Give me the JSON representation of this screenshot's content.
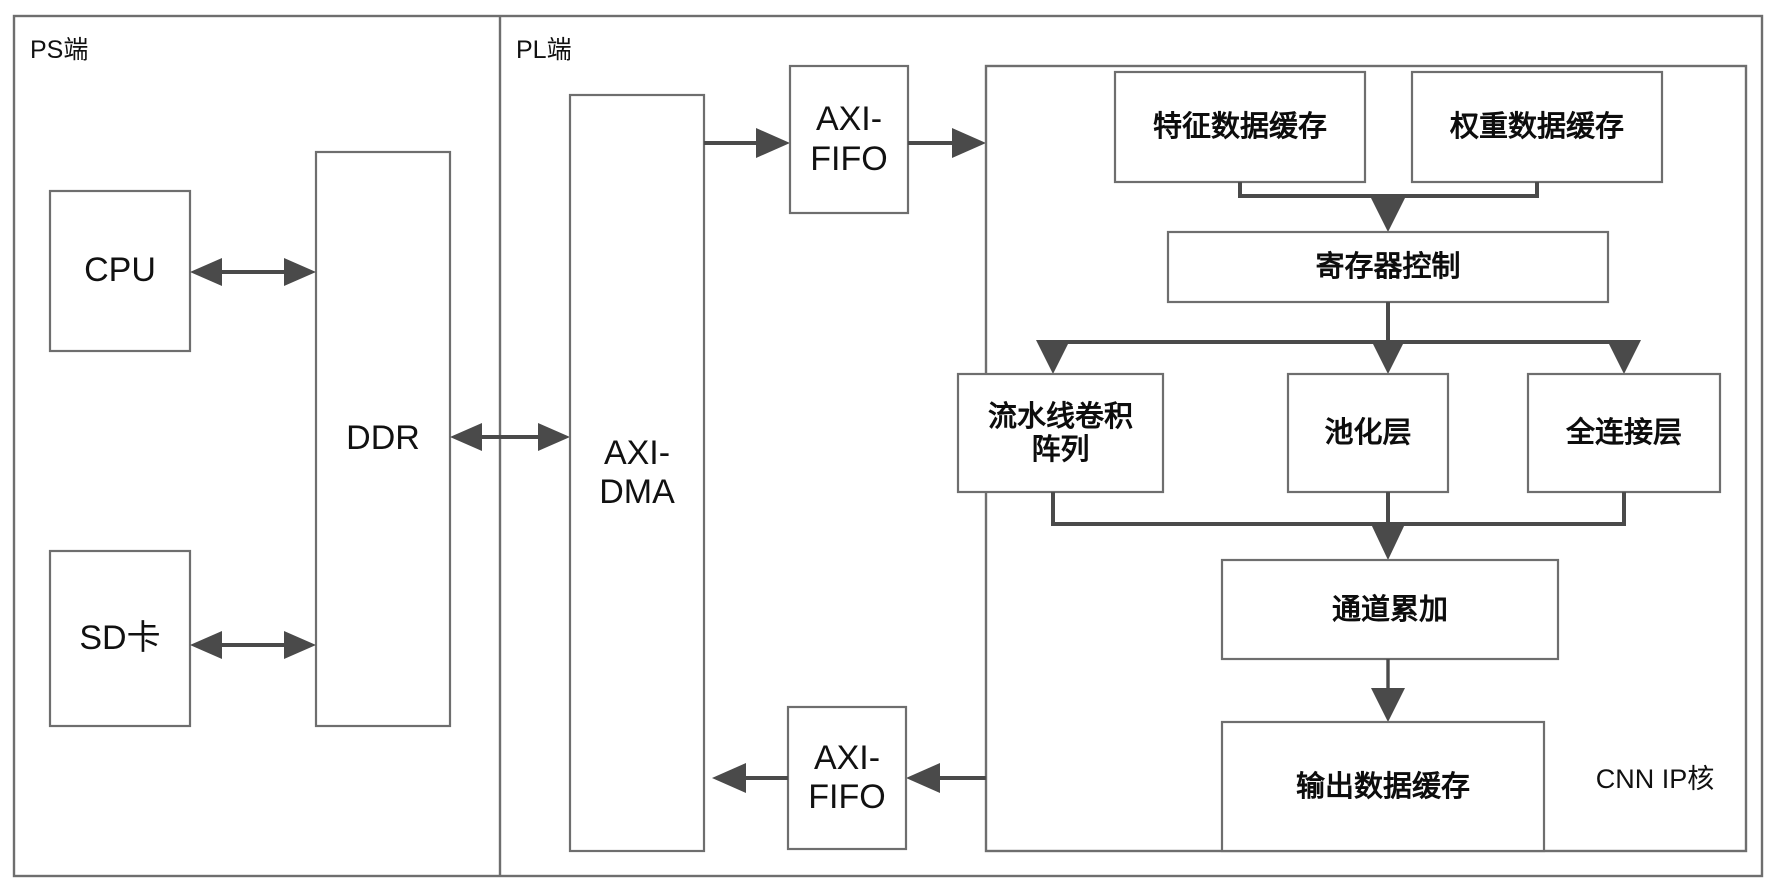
{
  "diagram": {
    "title": "FPGA SoC CNN Accelerator Block Diagram",
    "sections": [
      {
        "id": "ps",
        "label": "PS端"
      },
      {
        "id": "pl",
        "label": "PL端"
      }
    ],
    "corner_labels": [
      {
        "id": "cnn-ip-core",
        "label": "CNN IP核"
      }
    ],
    "blocks": [
      {
        "id": "cpu",
        "label": "CPU",
        "script": "latin"
      },
      {
        "id": "sd-card",
        "label": "SD卡",
        "script": "mixed"
      },
      {
        "id": "ddr",
        "label": "DDR",
        "script": "latin"
      },
      {
        "id": "axi-dma",
        "label": "AXI-\nDMA",
        "script": "latin"
      },
      {
        "id": "axi-fifo-in",
        "label": "AXI-\nFIFO",
        "script": "latin"
      },
      {
        "id": "axi-fifo-out",
        "label": "AXI-\nFIFO",
        "script": "latin"
      },
      {
        "id": "feature-buffer",
        "label": "特征数据缓存",
        "script": "cjk"
      },
      {
        "id": "weight-buffer",
        "label": "权重数据缓存",
        "script": "cjk"
      },
      {
        "id": "register-ctrl",
        "label": "寄存器控制",
        "script": "cjk"
      },
      {
        "id": "conv-array",
        "label": "流水线卷积\n阵列",
        "script": "cjk"
      },
      {
        "id": "pooling-layer",
        "label": "池化层",
        "script": "cjk"
      },
      {
        "id": "fc-layer",
        "label": "全连接层",
        "script": "cjk"
      },
      {
        "id": "channel-accum",
        "label": "通道累加",
        "script": "cjk"
      },
      {
        "id": "output-buffer",
        "label": "输出数据缓存",
        "script": "cjk"
      }
    ],
    "connections": [
      {
        "from": "cpu",
        "to": "ddr",
        "style": "bidirectional"
      },
      {
        "from": "sd-card",
        "to": "ddr",
        "style": "bidirectional"
      },
      {
        "from": "ddr",
        "to": "axi-dma",
        "style": "bidirectional"
      },
      {
        "from": "axi-dma",
        "to": "axi-fifo-in",
        "style": "directed"
      },
      {
        "from": "axi-fifo-in",
        "to": "cnn-ip-core",
        "style": "directed"
      },
      {
        "from": "feature-buffer",
        "to": "register-ctrl",
        "style": "directed"
      },
      {
        "from": "weight-buffer",
        "to": "register-ctrl",
        "style": "directed"
      },
      {
        "from": "register-ctrl",
        "to": "conv-array",
        "style": "directed"
      },
      {
        "from": "register-ctrl",
        "to": "pooling-layer",
        "style": "directed"
      },
      {
        "from": "register-ctrl",
        "to": "fc-layer",
        "style": "directed"
      },
      {
        "from": "conv-array",
        "to": "channel-accum",
        "style": "directed"
      },
      {
        "from": "pooling-layer",
        "to": "channel-accum",
        "style": "directed"
      },
      {
        "from": "fc-layer",
        "to": "channel-accum",
        "style": "directed"
      },
      {
        "from": "channel-accum",
        "to": "output-buffer",
        "style": "directed"
      },
      {
        "from": "output-buffer",
        "to": "axi-fifo-out",
        "style": "directed"
      },
      {
        "from": "axi-fifo-out",
        "to": "axi-dma",
        "style": "directed"
      }
    ],
    "colors": {
      "background": "#ffffff",
      "box_fill": "#ffffff",
      "box_stroke": "#6e6e6e",
      "connector": "#4a4a4a",
      "text": "#111111"
    }
  }
}
